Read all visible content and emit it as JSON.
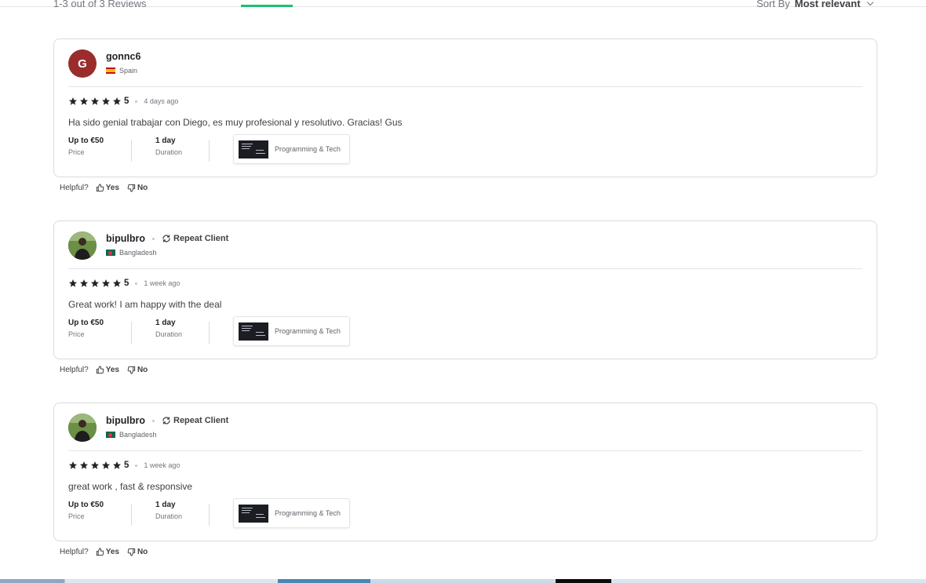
{
  "header": {
    "count_text": "1-3 out of 3 Reviews",
    "sort_label": "Sort By",
    "sort_value": "Most relevant"
  },
  "colors": {
    "accent_green": "#1dbf73",
    "star": "#222325",
    "border": "#dadbdd"
  },
  "labels": {
    "helpful": "Helpful?",
    "yes": "Yes",
    "no": "No",
    "repeat_client": "Repeat Client",
    "price_label": "Price",
    "duration_label": "Duration"
  },
  "reviews": [
    {
      "username": "gonnc6",
      "avatar_letter": "G",
      "avatar_type": "letter",
      "country": "Spain",
      "flag_icon": "spain-flag-icon",
      "repeat_client": false,
      "rating": "5",
      "stars": 5,
      "time_ago": "4 days ago",
      "comment": "Ha sido genial trabajar con Diego, es muy profesional y resolutivo. Gracias! Gus",
      "price": "Up to €50",
      "duration": "1 day",
      "gig_category": "Programming & Tech"
    },
    {
      "username": "bipulbro",
      "avatar_type": "photo",
      "country": "Bangladesh",
      "flag_icon": "bangladesh-flag-icon",
      "repeat_client": true,
      "rating": "5",
      "stars": 5,
      "time_ago": "1 week ago",
      "comment": "Great work! I am happy with the deal",
      "price": "Up to €50",
      "duration": "1 day",
      "gig_category": "Programming & Tech"
    },
    {
      "username": "bipulbro",
      "avatar_type": "photo",
      "country": "Bangladesh",
      "flag_icon": "bangladesh-flag-icon",
      "repeat_client": true,
      "rating": "5",
      "stars": 5,
      "time_ago": "1 week ago",
      "comment": "great work , fast & responsive",
      "price": "Up to €50",
      "duration": "1 day",
      "gig_category": "Programming & Tech"
    }
  ]
}
